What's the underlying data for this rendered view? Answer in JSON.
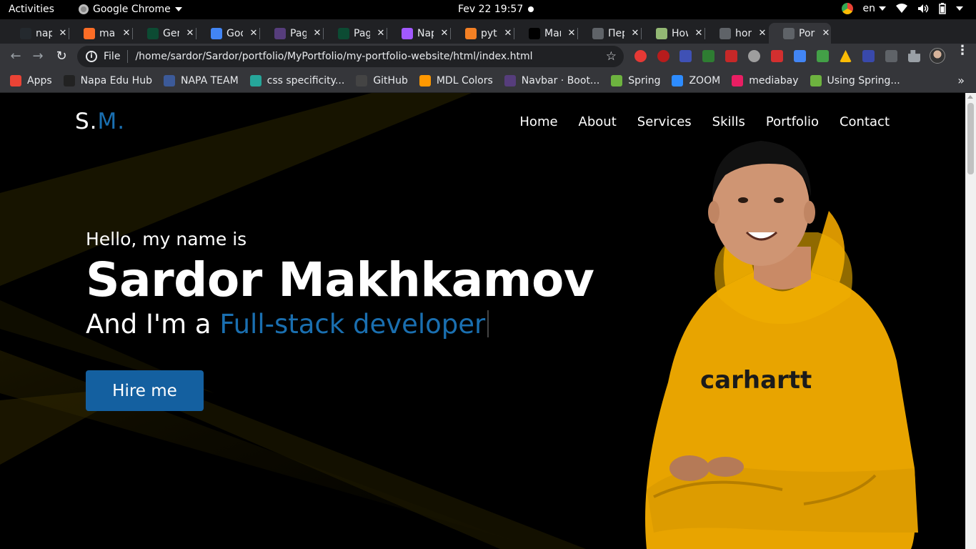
{
  "os_topbar": {
    "activities": "Activities",
    "app_name": "Google Chrome",
    "clock": "Fev 22  19:57",
    "lang": "en"
  },
  "tabs": [
    {
      "title": "nap",
      "favicon": "github-icon",
      "color": "#24292e"
    },
    {
      "title": "mai",
      "favicon": "gitlab-icon",
      "color": "#fc6d26"
    },
    {
      "title": "Gen",
      "favicon": "django-icon",
      "color": "#0c4b33"
    },
    {
      "title": "Goo",
      "favicon": "translate-icon",
      "color": "#4285f4"
    },
    {
      "title": "Pag",
      "favicon": "bootstrap-icon",
      "color": "#563d7c"
    },
    {
      "title": "Pag",
      "favicon": "django-icon",
      "color": "#0c4b33"
    },
    {
      "title": "Nap",
      "favicon": "figma-icon",
      "color": "#a259ff"
    },
    {
      "title": "pyt",
      "favicon": "stackoverflow-icon",
      "color": "#f48024"
    },
    {
      "title": "Mar",
      "favicon": "jetbrains-icon",
      "color": "#000000"
    },
    {
      "title": "Пер",
      "favicon": "globe-icon",
      "color": "#5f6368"
    },
    {
      "title": "How",
      "favicon": "wikihow-icon",
      "color": "#93b874"
    },
    {
      "title": "hor",
      "favicon": "globe-icon",
      "color": "#5f6368"
    },
    {
      "title": "Por",
      "favicon": "globe-icon",
      "color": "#5f6368",
      "active": true
    }
  ],
  "omnibox": {
    "scheme": "File",
    "url": "/home/sardor/Sardor/portfolio/MyPortfolio/my-portfolio-website/html/index.html"
  },
  "bookmarks": [
    {
      "label": "Apps",
      "icon": "apps-grid-icon",
      "color": "#ea4335"
    },
    {
      "label": "Napa Edu Hub",
      "icon": "napa-icon",
      "color": "#222222"
    },
    {
      "label": "NAPA TEAM",
      "icon": "napa-team-icon",
      "color": "#3c5a99"
    },
    {
      "label": "css specificity...",
      "icon": "css-icon",
      "color": "#26a69a"
    },
    {
      "label": "GitHub",
      "icon": "github-icon",
      "color": "#444444"
    },
    {
      "label": "MDL Colors",
      "icon": "mdl-icon",
      "color": "#ff9800"
    },
    {
      "label": "Navbar · Boot...",
      "icon": "bootstrap-icon",
      "color": "#563d7c"
    },
    {
      "label": "Spring",
      "icon": "spring-icon",
      "color": "#6db33f"
    },
    {
      "label": "ZOOM",
      "icon": "zoom-icon",
      "color": "#2d8cff"
    },
    {
      "label": "mediabay",
      "icon": "mediabay-icon",
      "color": "#e91e63"
    },
    {
      "label": "Using Spring...",
      "icon": "spring-icon",
      "color": "#6db33f"
    }
  ],
  "site": {
    "logo_main": "S.",
    "logo_accent": "M.",
    "nav": [
      "Home",
      "About",
      "Services",
      "Skills",
      "Portfolio",
      "Contact"
    ],
    "greeting": "Hello, my name is",
    "name": "Sardor Makhkamov",
    "role_prefix": "And I'm a ",
    "role_typed": "Full-stack developer",
    "cta": "Hire me",
    "hoodie_text": "carhartt",
    "accent_color": "#1a6fb0"
  }
}
